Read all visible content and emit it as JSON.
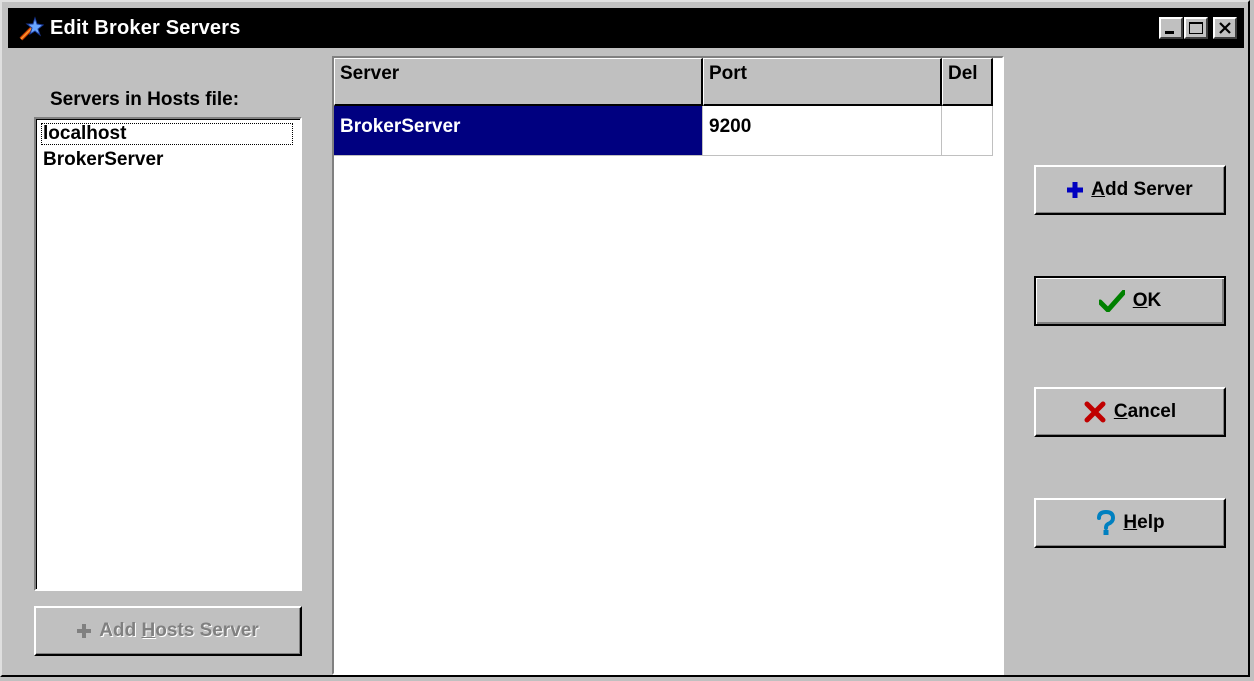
{
  "window": {
    "title": "Edit Broker Servers",
    "controls": {
      "minimize": "minimize",
      "maximize": "maximize",
      "close": "close"
    }
  },
  "hosts": {
    "label": "Servers in Hosts file:",
    "items": [
      "localhost",
      "BrokerServer"
    ],
    "focused_index": 0,
    "add_button": {
      "prefix": "Add ",
      "mnemonic": "H",
      "suffix": "osts Server",
      "enabled": false
    }
  },
  "grid": {
    "columns": [
      "Server",
      "Port",
      "Del"
    ],
    "rows": [
      {
        "server": "BrokerServer",
        "port": "9200",
        "del": ""
      }
    ],
    "selected_row": 0
  },
  "buttons": {
    "add_server": {
      "mnemonic": "A",
      "suffix": "dd Server",
      "icon": "plus-icon"
    },
    "ok": {
      "mnemonic": "O",
      "suffix": "K",
      "icon": "checkmark-icon"
    },
    "cancel": {
      "mnemonic": "C",
      "suffix": "ancel",
      "icon": "x-icon"
    },
    "help": {
      "mnemonic": "H",
      "suffix": "elp",
      "icon": "question-icon"
    }
  },
  "colors": {
    "titlebar": "#000000",
    "selection": "#000080",
    "face": "#c0c0c0",
    "plus_icon": "#0000c0",
    "check_icon": "#008000",
    "x_icon": "#c00000",
    "help_icon": "#0080c0"
  }
}
